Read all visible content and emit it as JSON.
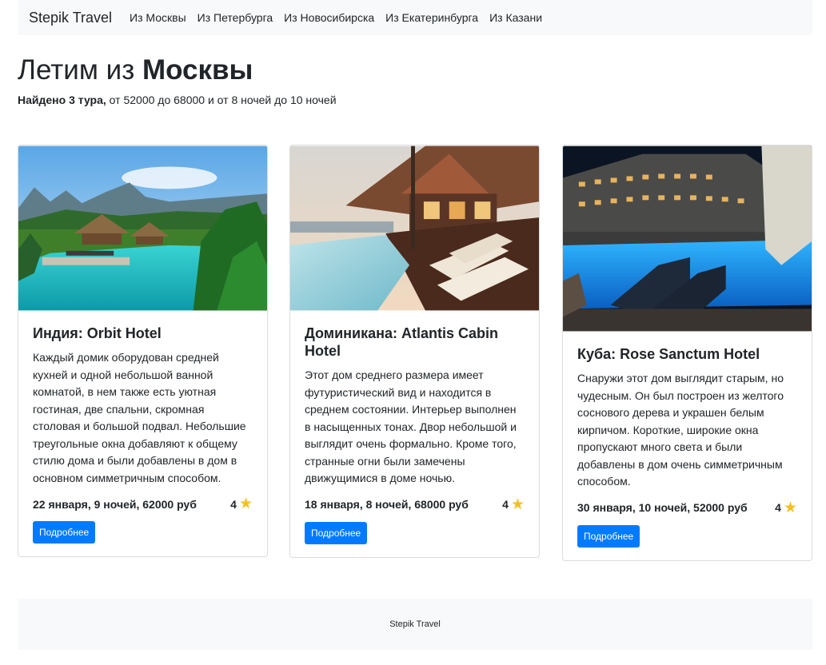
{
  "navbar": {
    "brand": "Stepik Travel",
    "links": [
      "Из Москвы",
      "Из Петербурга",
      "Из Новосибирска",
      "Из Екатеринбурга",
      "Из Казани"
    ]
  },
  "header": {
    "title_prefix": "Летим из",
    "title_city": "Москвы",
    "summary_bold": "Найдено 3 тура,",
    "summary_rest": " от 52000 до 68000 и от 8 ночей до 10 ночей"
  },
  "tours": [
    {
      "title": "Индия: Orbit Hotel",
      "description": "Каждый домик оборудован средней кухней и одной небольшой ванной комнатой, в нем также есть уютная гостиная, две спальни, скромная столовая и большой подвал. Небольшие треугольные окна добавляют к общему стилю дома и были добавлены в дом в основном симметричным способом.",
      "details": "22 января, 9 ночей, 62000 руб",
      "stars": "4",
      "button": "Подробнее",
      "image": "photo of a tropical resort pool with thatched huts, palms and mountains"
    },
    {
      "title": "Доминикана: Atlantis Cabin Hotel",
      "description": "Этот дом среднего размера имеет футуристический вид и находится в среднем состоянии. Интерьер выполнен в насыщенных тонах. Двор небольшой и выглядит очень формально. Кроме того, странные огни были замечены движущимися в доме ночью.",
      "details": "18 января, 8 ночей, 68000 руб",
      "stars": "4",
      "button": "Подробнее",
      "image": "photo of a wooden cabin resort with deck chairs beside a pool at sunset"
    },
    {
      "title": "Куба: Rose Sanctum Hotel",
      "description": "Снаружи этот дом выглядит старым, но чудесным. Он был построен из желтого соснового дерева и украшен белым кирпичом. Короткие, широкие окна пропускают много света и были добавлены в дом очень симметричным способом.",
      "details": "30 января, 10 ночей, 52000 руб",
      "stars": "4",
      "button": "Подробнее",
      "image": "photo of a lit hotel pool at night with lounge chairs"
    }
  ],
  "footer": {
    "text": "Stepik Travel"
  },
  "colors": {
    "accent": "#007bff",
    "star": "#f4c020",
    "navbar_bg": "#f8f9fa"
  },
  "icons": [
    "star-icon"
  ]
}
